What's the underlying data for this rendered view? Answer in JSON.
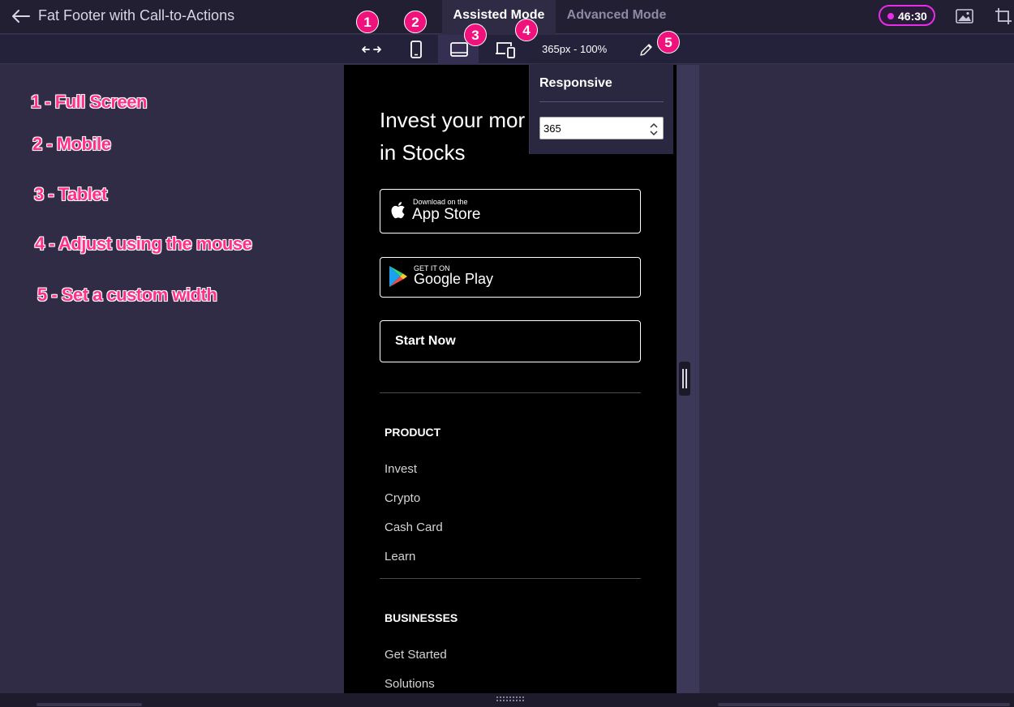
{
  "header": {
    "title": "Fat Footer with Call-to-Actions",
    "modes": [
      "Assisted Mode",
      "Advanced Mode"
    ],
    "timer": "46:30"
  },
  "toolbar": {
    "width_readout": "365px - 100%"
  },
  "badges": [
    "1",
    "2",
    "3",
    "4",
    "5"
  ],
  "annotations": [
    "1 - Full Screen",
    "2 - Mobile",
    "3 - Tablet",
    "4 - Adjust using the mouse",
    "5 - Set a custom width"
  ],
  "popup": {
    "title": "Responsive",
    "width_value": "365"
  },
  "preview": {
    "headline_line1": "Invest your mor",
    "headline_line2": "in Stocks",
    "appstore": {
      "small": "Download on the",
      "big": "App Store"
    },
    "googleplay": {
      "small": "GET IT ON",
      "big": "Google Play"
    },
    "start_button": "Start Now",
    "sections": [
      {
        "heading": "PRODUCT",
        "links": [
          "Invest",
          "Crypto",
          "Cash Card",
          "Learn"
        ]
      },
      {
        "heading": "BUSINESSES",
        "links": [
          "Get Started",
          "Solutions"
        ]
      }
    ]
  },
  "colors": {
    "accent_pink": "#f0117d",
    "timer_magenta": "#e62ee6",
    "background": "#302c45",
    "preview_bg": "#000000"
  }
}
